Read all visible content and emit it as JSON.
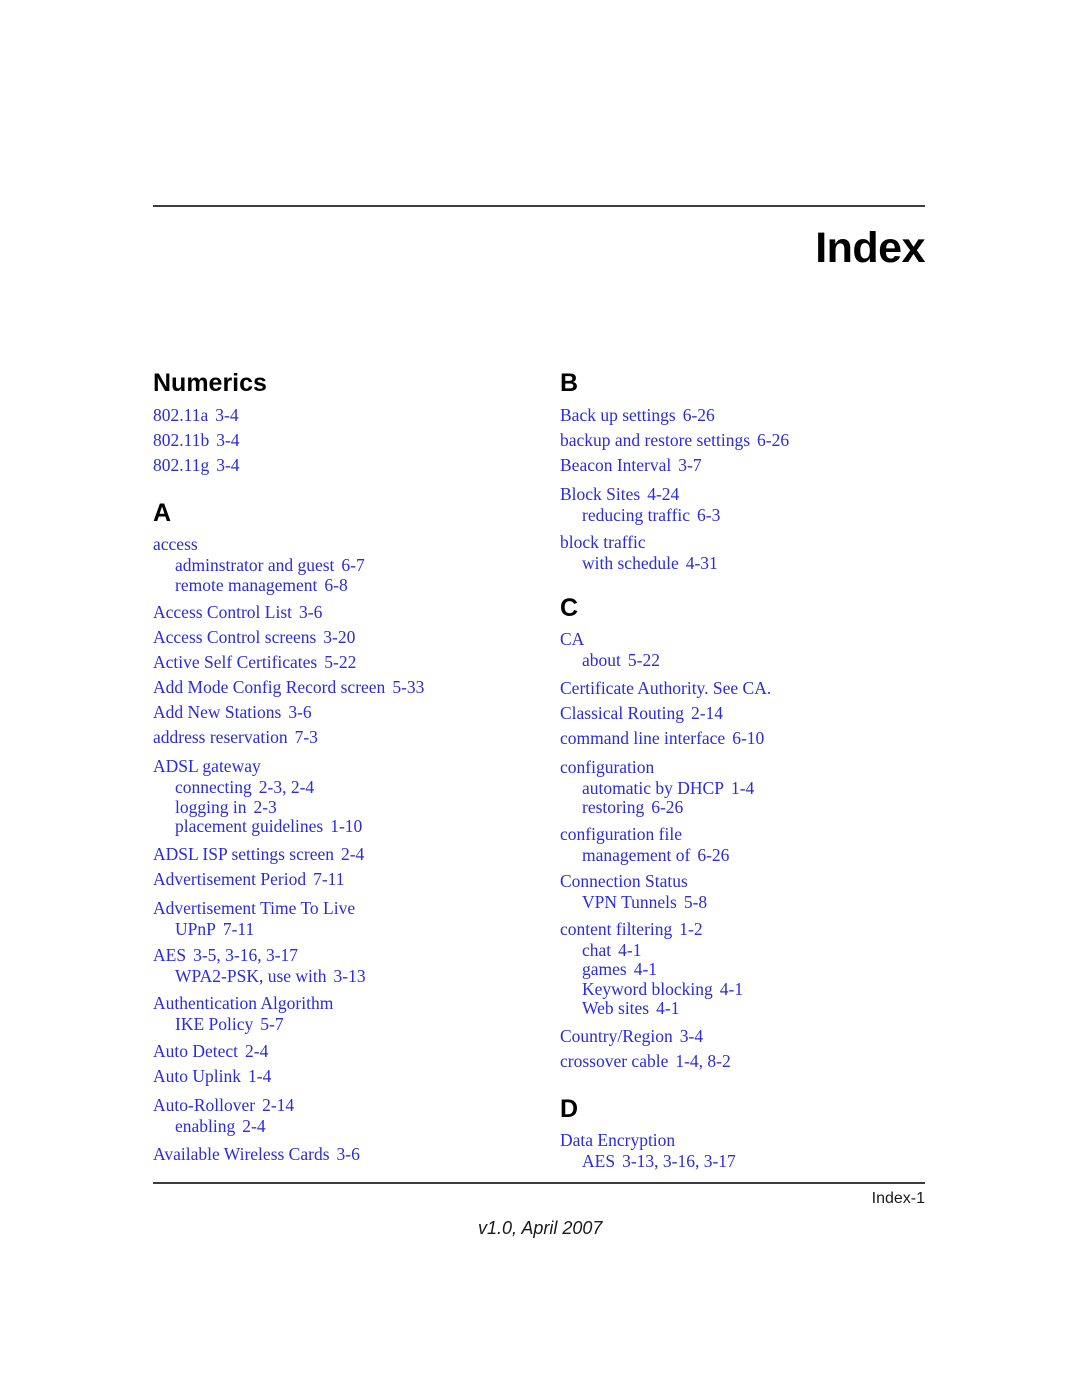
{
  "document": {
    "title": "Index",
    "folio": "Index-1",
    "revision": "v1.0, April 2007",
    "link_color": "#2a2ae8",
    "rule_color": "#3d3d3d"
  },
  "columns": {
    "left": [
      {
        "heading": "Numerics",
        "groups": [
          {
            "entry": "802.11a",
            "locators": "3-4",
            "subentries": []
          },
          {
            "entry": "802.11b",
            "locators": "3-4",
            "subentries": []
          },
          {
            "entry": "802.11g",
            "locators": "3-4",
            "subentries": []
          }
        ]
      },
      {
        "heading": "A",
        "groups": [
          {
            "entry": "access",
            "locators": "",
            "subentries": [
              {
                "entry": "adminstrator and guest",
                "locators": "6-7"
              },
              {
                "entry": "remote management",
                "locators": "6-8"
              }
            ]
          },
          {
            "entry": "Access Control List",
            "locators": "3-6",
            "subentries": []
          },
          {
            "entry": "Access Control screens",
            "locators": "3-20",
            "subentries": []
          },
          {
            "entry": "Active Self Certificates",
            "locators": "5-22",
            "subentries": []
          },
          {
            "entry": "Add Mode Config Record screen",
            "locators": "5-33",
            "subentries": []
          },
          {
            "entry": "Add New Stations",
            "locators": "3-6",
            "subentries": []
          },
          {
            "entry": "address reservation",
            "locators": "7-3",
            "subentries": []
          },
          {
            "entry": "ADSL gateway",
            "locators": "",
            "subentries": [
              {
                "entry": "connecting",
                "locators": "2-3, 2-4"
              },
              {
                "entry": "logging in",
                "locators": "2-3"
              },
              {
                "entry": "placement guidelines",
                "locators": "1-10"
              }
            ]
          },
          {
            "entry": "ADSL ISP settings screen",
            "locators": "2-4",
            "subentries": []
          },
          {
            "entry": "Advertisement Period",
            "locators": "7-11",
            "subentries": []
          },
          {
            "entry": "Advertisement Time To Live",
            "locators": "",
            "subentries": [
              {
                "entry": "UPnP",
                "locators": "7-11"
              }
            ]
          },
          {
            "entry": "AES",
            "locators": "3-5, 3-16, 3-17",
            "subentries": [
              {
                "entry": "WPA2-PSK, use with",
                "locators": "3-13"
              }
            ]
          },
          {
            "entry": "Authentication Algorithm",
            "locators": "",
            "subentries": [
              {
                "entry": "IKE Policy",
                "locators": "5-7"
              }
            ]
          },
          {
            "entry": "Auto Detect",
            "locators": "2-4",
            "subentries": []
          },
          {
            "entry": "Auto Uplink",
            "locators": "1-4",
            "subentries": []
          },
          {
            "entry": "Auto-Rollover",
            "locators": "2-14",
            "subentries": [
              {
                "entry": "enabling",
                "locators": "2-4"
              }
            ]
          },
          {
            "entry": "Available Wireless Cards",
            "locators": "3-6",
            "subentries": []
          }
        ]
      }
    ],
    "right": [
      {
        "heading": "B",
        "groups": [
          {
            "entry": "Back up settings",
            "locators": "6-26",
            "subentries": []
          },
          {
            "entry": "backup and restore settings",
            "locators": "6-26",
            "subentries": []
          },
          {
            "entry": "Beacon Interval",
            "locators": "3-7",
            "subentries": []
          },
          {
            "entry": "Block Sites",
            "locators": "4-24",
            "subentries": [
              {
                "entry": "reducing traffic",
                "locators": "6-3"
              }
            ]
          },
          {
            "entry": "block traffic",
            "locators": "",
            "subentries": [
              {
                "entry": "with schedule",
                "locators": "4-31"
              }
            ]
          }
        ]
      },
      {
        "heading": "C",
        "groups": [
          {
            "entry": "CA",
            "locators": "",
            "subentries": [
              {
                "entry": "about",
                "locators": "5-22"
              }
            ]
          },
          {
            "entry": "Certificate Authority. See CA.",
            "locators": "",
            "subentries": []
          },
          {
            "entry": "Classical Routing",
            "locators": "2-14",
            "subentries": []
          },
          {
            "entry": "command line interface",
            "locators": "6-10",
            "subentries": []
          },
          {
            "entry": "configuration",
            "locators": "",
            "subentries": [
              {
                "entry": "automatic by DHCP",
                "locators": "1-4"
              },
              {
                "entry": "restoring",
                "locators": "6-26"
              }
            ]
          },
          {
            "entry": "configuration file",
            "locators": "",
            "subentries": [
              {
                "entry": "management of",
                "locators": "6-26"
              }
            ]
          },
          {
            "entry": "Connection Status",
            "locators": "",
            "subentries": [
              {
                "entry": "VPN Tunnels",
                "locators": "5-8"
              }
            ]
          },
          {
            "entry": "content filtering",
            "locators": "1-2",
            "subentries": [
              {
                "entry": "chat",
                "locators": "4-1"
              },
              {
                "entry": "games",
                "locators": "4-1"
              },
              {
                "entry": "Keyword blocking",
                "locators": "4-1"
              },
              {
                "entry": "Web sites",
                "locators": "4-1"
              }
            ]
          },
          {
            "entry": "Country/Region",
            "locators": "3-4",
            "subentries": []
          },
          {
            "entry": "crossover cable",
            "locators": "1-4, 8-2",
            "subentries": []
          }
        ]
      },
      {
        "heading": "D",
        "groups": [
          {
            "entry": "Data Encryption",
            "locators": "",
            "subentries": [
              {
                "entry": "AES",
                "locators": "3-13, 3-16, 3-17"
              }
            ]
          }
        ]
      }
    ]
  }
}
